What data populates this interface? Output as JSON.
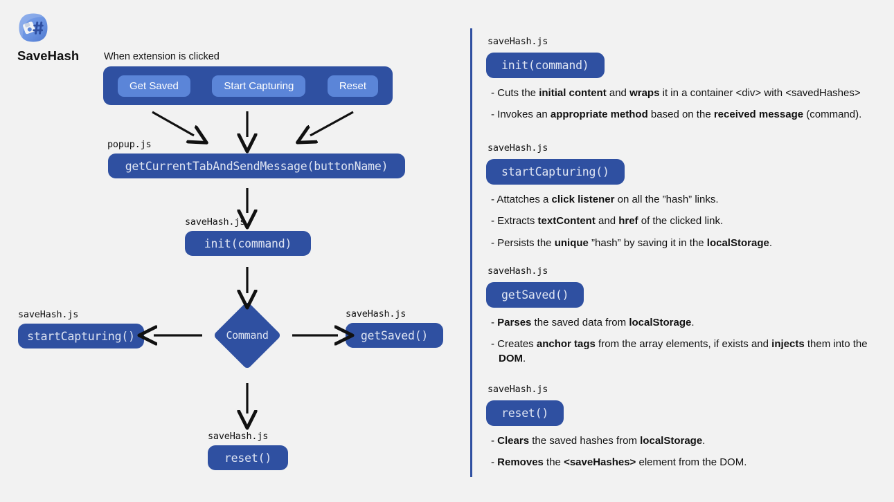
{
  "app": {
    "name": "SaveHash",
    "icon": "savehash-app-icon"
  },
  "flow": {
    "trigger_caption": "When extension is clicked",
    "toolbar_buttons": [
      {
        "label": "Get Saved"
      },
      {
        "label": "Start Capturing"
      },
      {
        "label": "Reset"
      }
    ],
    "popup_file": "popup.js",
    "popup_fn": "getCurrentTabAndSendMessage(buttonName)",
    "init_file": "saveHash.js",
    "init_fn": "init(command)",
    "decision_label": "Command",
    "left_file": "saveHash.js",
    "left_fn": "startCapturing()",
    "right_file": "saveHash.js",
    "right_fn": "getSaved()",
    "bottom_file": "saveHash.js",
    "bottom_fn": "reset()"
  },
  "details": [
    {
      "file": "saveHash.js",
      "fn": "init(command)",
      "bullets": [
        [
          {
            "t": "- Cuts the ",
            "b": false
          },
          {
            "t": "initial content",
            "b": true
          },
          {
            "t": " and ",
            "b": false
          },
          {
            "t": "wraps",
            "b": true
          },
          {
            "t": " it in a container <div> with <savedHashes>",
            "b": false
          }
        ],
        [
          {
            "t": "- Invokes an ",
            "b": false
          },
          {
            "t": "appropriate method",
            "b": true
          },
          {
            "t": " based on the ",
            "b": false
          },
          {
            "t": "received message",
            "b": true
          },
          {
            "t": " (command).",
            "b": false
          }
        ]
      ]
    },
    {
      "file": "saveHash.js",
      "fn": "startCapturing()",
      "bullets": [
        [
          {
            "t": "- Attatches a ",
            "b": false
          },
          {
            "t": "click listener",
            "b": true
          },
          {
            "t": " on all the ”hash” links.",
            "b": false
          }
        ],
        [
          {
            "t": "- Extracts ",
            "b": false
          },
          {
            "t": "textContent",
            "b": true
          },
          {
            "t": " and ",
            "b": false
          },
          {
            "t": "href",
            "b": true
          },
          {
            "t": " of the clicked link.",
            "b": false
          }
        ],
        [
          {
            "t": "- Persists the ",
            "b": false
          },
          {
            "t": "unique",
            "b": true
          },
          {
            "t": " ”hash” by saving it in the ",
            "b": false
          },
          {
            "t": "localStorage",
            "b": true
          },
          {
            "t": ".",
            "b": false
          }
        ]
      ]
    },
    {
      "file": "saveHash.js",
      "fn": "getSaved()",
      "bullets": [
        [
          {
            "t": "- ",
            "b": false
          },
          {
            "t": "Parses",
            "b": true
          },
          {
            "t": " the saved data from ",
            "b": false
          },
          {
            "t": "localStorage",
            "b": true
          },
          {
            "t": ".",
            "b": false
          }
        ],
        [
          {
            "t": "- Creates ",
            "b": false
          },
          {
            "t": "anchor tags",
            "b": true
          },
          {
            "t": " from the array elements, if exists and ",
            "b": false
          },
          {
            "t": "injects",
            "b": true
          },
          {
            "t": " them into the ",
            "b": false
          },
          {
            "t": "DOM",
            "b": true
          },
          {
            "t": ".",
            "b": false
          }
        ]
      ]
    },
    {
      "file": "saveHash.js",
      "fn": "reset()",
      "bullets": [
        [
          {
            "t": "- ",
            "b": false
          },
          {
            "t": "Clears",
            "b": true
          },
          {
            "t": " the saved hashes from ",
            "b": false
          },
          {
            "t": "localStorage",
            "b": true
          },
          {
            "t": ".",
            "b": false
          }
        ],
        [
          {
            "t": "- ",
            "b": false
          },
          {
            "t": "Removes",
            "b": true
          },
          {
            "t": " the ",
            "b": false
          },
          {
            "t": "<saveHashes>",
            "b": true
          },
          {
            "t": " element from the DOM.",
            "b": false
          }
        ]
      ]
    }
  ],
  "colors": {
    "background": "#f2f2f2",
    "node_blue": "#2f50a1",
    "button_blue": "#5b85d8",
    "node_text": "#dfe5f3",
    "arrow": "#111111"
  }
}
